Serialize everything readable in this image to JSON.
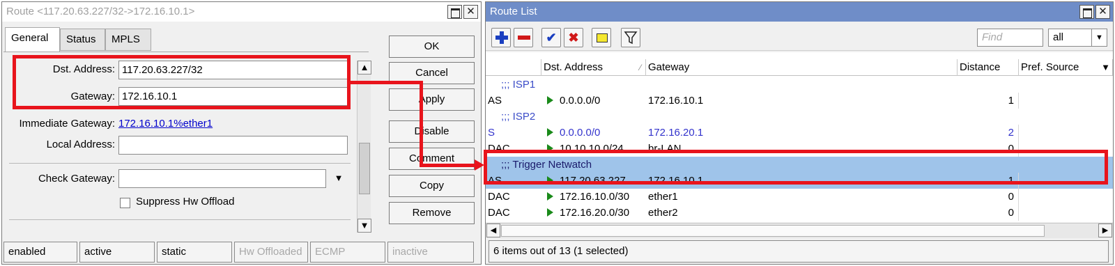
{
  "route_dialog": {
    "title": "Route <117.20.63.227/32->172.16.10.1>",
    "tabs": [
      {
        "label": "General",
        "selected": true
      },
      {
        "label": "Status",
        "selected": false
      },
      {
        "label": "MPLS",
        "selected": false
      }
    ],
    "fields": {
      "dst_address_label": "Dst. Address:",
      "dst_address_value": "117.20.63.227/32",
      "gateway_label": "Gateway:",
      "gateway_value": "172.16.10.1",
      "immediate_gateway_label": "Immediate Gateway:",
      "immediate_gateway_value": "172.16.10.1%ether1",
      "local_address_label": "Local Address:",
      "local_address_value": "",
      "check_gateway_label": "Check Gateway:",
      "check_gateway_value": "",
      "suppress_hw_offload_label": "Suppress Hw Offload",
      "suppress_hw_offload_checked": false
    },
    "buttons": {
      "ok": "OK",
      "cancel": "Cancel",
      "apply": "Apply",
      "disable": "Disable",
      "comment": "Comment",
      "copy": "Copy",
      "remove": "Remove"
    },
    "status": {
      "enabled": "enabled",
      "active": "active",
      "static": "static",
      "hw_offloaded": "Hw Offloaded",
      "ecmp": "ECMP",
      "inactive": "inactive"
    }
  },
  "route_list": {
    "title": "Route List",
    "find_placeholder": "Find",
    "filter_value": "all",
    "columns": [
      "Dst. Address",
      "Gateway",
      "Distance",
      "Pref. Source"
    ],
    "rows": [
      {
        "kind": "comment",
        "text": ";;; ISP1"
      },
      {
        "kind": "route",
        "flags": "AS",
        "dst": "0.0.0.0/0",
        "gateway": "172.16.10.1",
        "distance": "1",
        "style": "normal"
      },
      {
        "kind": "comment",
        "text": ";;; ISP2"
      },
      {
        "kind": "route",
        "flags": "S",
        "dst": "0.0.0.0/0",
        "gateway": "172.16.20.1",
        "distance": "2",
        "style": "blue"
      },
      {
        "kind": "route",
        "flags": "DAC",
        "dst": "10.10.10.0/24",
        "gateway": "br-LAN",
        "distance": "0",
        "style": "normal"
      },
      {
        "kind": "comment",
        "text": ";;; Trigger Netwatch",
        "selected": true
      },
      {
        "kind": "route",
        "flags": "AS",
        "dst": "117.20.63.227",
        "gateway": "172.16.10.1",
        "distance": "1",
        "style": "normal",
        "selected": true
      },
      {
        "kind": "route",
        "flags": "DAC",
        "dst": "172.16.10.0/30",
        "gateway": "ether1",
        "distance": "0",
        "style": "normal"
      },
      {
        "kind": "route",
        "flags": "DAC",
        "dst": "172.16.20.0/30",
        "gateway": "ether2",
        "distance": "0",
        "style": "normal"
      }
    ],
    "status_text": "6 items out of 13 (1 selected)"
  },
  "colors": {
    "annotation": "#e8141c",
    "selected_row": "#9fc4ea",
    "title_bar_active": "#6f8dc8",
    "blue_text": "#3333cc"
  }
}
